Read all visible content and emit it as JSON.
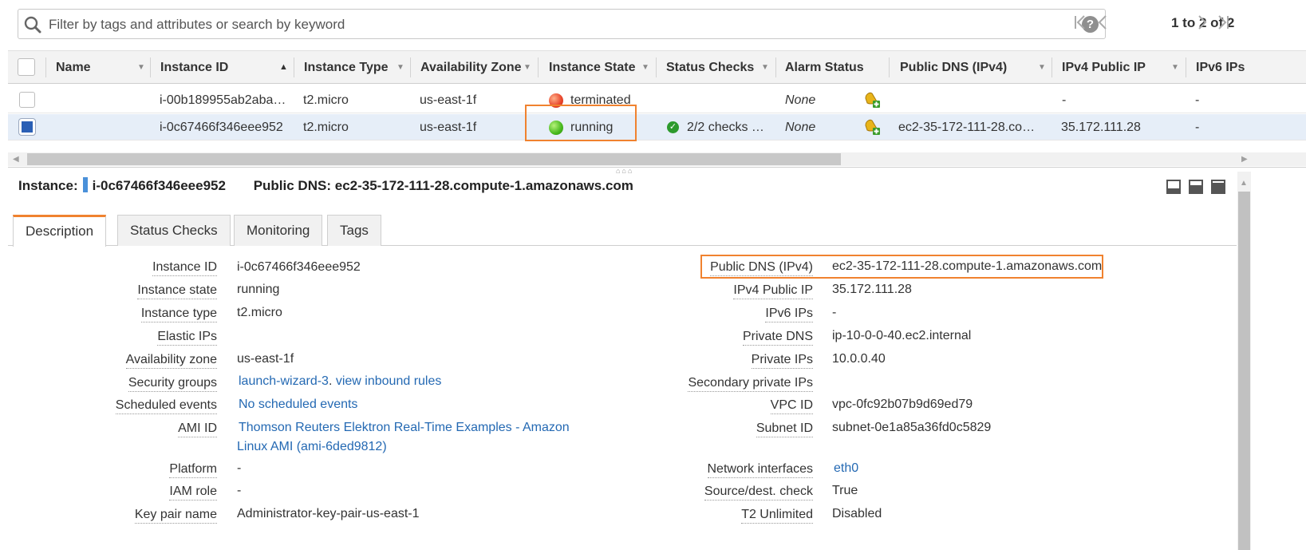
{
  "search": {
    "placeholder": "Filter by tags and attributes or search by keyword",
    "help": "?"
  },
  "pager": {
    "text": "1 to 2 of 2",
    "first": "|‹",
    "prev": "‹",
    "next": "›",
    "last": "›|"
  },
  "columns": {
    "name": "Name",
    "instance_id": "Instance ID",
    "instance_type": "Instance Type",
    "availability_zone": "Availability Zone",
    "instance_state": "Instance State",
    "status_checks": "Status Checks",
    "alarm_status": "Alarm Status",
    "public_dns": "Public DNS (IPv4)",
    "ipv4_public_ip": "IPv4 Public IP",
    "ipv6_ips": "IPv6 IPs"
  },
  "rows": [
    {
      "name": "",
      "instance_id": "i-00b189955ab2aba…",
      "instance_type": "t2.micro",
      "availability_zone": "us-east-1f",
      "state": "terminated",
      "state_color": "#e8442a",
      "status_checks": "",
      "alarm_status": "None",
      "public_dns": "",
      "ipv4": "-",
      "ipv6": "-",
      "selected": false
    },
    {
      "name": "",
      "instance_id": "i-0c67466f346eee952",
      "instance_type": "t2.micro",
      "availability_zone": "us-east-1f",
      "state": "running",
      "state_color": "#46b81d",
      "status_checks": "2/2 checks …",
      "alarm_status": "None",
      "public_dns": "ec2-35-172-111-28.co…",
      "ipv4": "35.172.111.28",
      "ipv6": "-",
      "selected": true
    }
  ],
  "detail": {
    "instance_label": "Instance:",
    "instance_id": "i-0c67466f346eee952",
    "dns_label": "Public DNS:",
    "dns_value": "ec2-35-172-111-28.compute-1.amazonaws.com"
  },
  "tabs": [
    "Description",
    "Status Checks",
    "Monitoring",
    "Tags"
  ],
  "description_left": [
    {
      "label": "Instance ID",
      "value": "i-0c67466f346eee952"
    },
    {
      "label": "Instance state",
      "value": "running"
    },
    {
      "label": "Instance type",
      "value": "t2.micro"
    },
    {
      "label": "Elastic IPs",
      "value": ""
    },
    {
      "label": "Availability zone",
      "value": "us-east-1f"
    },
    {
      "label": "Security groups",
      "value": "launch-wizard-3",
      "sep": ".",
      "value2": "view inbound rules"
    },
    {
      "label": "Scheduled events",
      "value": "No scheduled events"
    },
    {
      "label": "AMI ID",
      "value": "Thomson Reuters Elektron Real-Time Examples - Amazon",
      "value2": "Linux AMI (ami-6ded9812)"
    },
    {
      "label": "Platform",
      "value": "-"
    },
    {
      "label": "IAM role",
      "value": "-"
    },
    {
      "label": "Key pair name",
      "value": "Administrator-key-pair-us-east-1"
    }
  ],
  "description_right": [
    {
      "label": "Public DNS (IPv4)",
      "value": "ec2-35-172-111-28.compute-1.amazonaws.com"
    },
    {
      "label": "IPv4 Public IP",
      "value": "35.172.111.28"
    },
    {
      "label": "IPv6 IPs",
      "value": "-"
    },
    {
      "label": "Private DNS",
      "value": "ip-10-0-0-40.ec2.internal"
    },
    {
      "label": "Private IPs",
      "value": "10.0.0.40"
    },
    {
      "label": "Secondary private IPs",
      "value": ""
    },
    {
      "label": "VPC ID",
      "value": "vpc-0fc92b07b9d69ed79"
    },
    {
      "label": "Subnet ID",
      "value": "subnet-0e1a85a36fd0c5829"
    },
    {
      "label": "Network interfaces",
      "value": "eth0"
    },
    {
      "label": "Source/dest. check",
      "value": "True"
    },
    {
      "label": "T2 Unlimited",
      "value": "Disabled"
    }
  ],
  "colors": {
    "accent": "#f0822f",
    "link": "#2469b3",
    "selected_row": "#e6eef8",
    "checkbox_selected": "#2a5fb5"
  }
}
